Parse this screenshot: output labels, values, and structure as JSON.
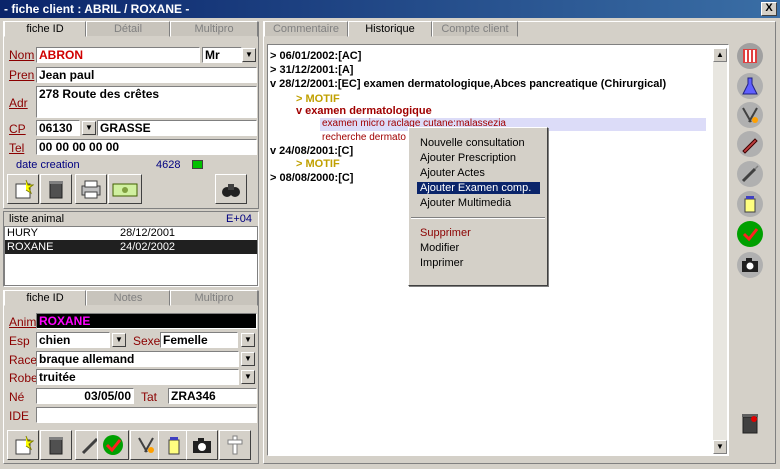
{
  "window": {
    "title": "- fiche client : ABRIL / ROXANE -",
    "close": "X"
  },
  "client": {
    "tabs": [
      "fiche ID",
      "Détail",
      "Multipro"
    ],
    "labels": {
      "nom": "Nom",
      "pren": "Pren",
      "adr": "Adr",
      "cp": "CP",
      "tel": "Tel"
    },
    "nom": "ABRON",
    "civ": "Mr",
    "prenom": "Jean paul",
    "adresse": "278 Route des crêtes",
    "cp": "06130",
    "ville": "GRASSE",
    "tel": "00 00 00 00 00",
    "date_creation_label": "date creation",
    "date_creation_value": "4628"
  },
  "animals": {
    "title": "liste animal",
    "count": "E+04",
    "rows": [
      {
        "name": "HURY",
        "date": "28/12/2001"
      },
      {
        "name": "ROXANE",
        "date": "24/02/2002"
      }
    ]
  },
  "animal": {
    "tabs": [
      "fiche ID",
      "Notes",
      "Multipro"
    ],
    "labels": {
      "anim": "Anim",
      "esp": "Esp",
      "sexe": "Sexe",
      "race": "Race",
      "robe": "Robe",
      "ne": "Né",
      "tat": "Tat",
      "ide": "IDE"
    },
    "anim": "ROXANE",
    "esp": "chien",
    "sexe": "Femelle",
    "race": "braque allemand",
    "robe": "truitée",
    "ne": "03/05/00",
    "tat": "ZRA346",
    "ide": ""
  },
  "history": {
    "tabs": [
      "Commentaire",
      "Historique",
      "Compte client"
    ],
    "lines": [
      "> 06/01/2002:[AC]",
      "> 31/12/2001:[A]",
      "v 28/12/2001:[EC] examen dermatologique,Abces pancreatique (Chirurgical)",
      "> MOTIF",
      "v examen dermatologique",
      "examen micro raclage cutane:malassezia",
      "recherche dermato",
      "v 24/08/2001:[C]",
      "> MOTIF",
      "> 08/08/2000:[C]"
    ]
  },
  "context_menu": {
    "items": [
      "Nouvelle consultation",
      "Ajouter Prescription",
      "Ajouter Actes",
      "Ajouter Examen comp.",
      "Ajouter Multimedia"
    ],
    "items2": [
      "Supprimer",
      "Modifier",
      "Imprimer"
    ],
    "selected": "Ajouter Examen comp."
  },
  "right_tools": [
    "book-icon",
    "flask-icon",
    "tools-icon",
    "pen-icon",
    "syringe-icon",
    "pills-icon",
    "check-icon",
    "camera-icon",
    "trash-icon"
  ]
}
